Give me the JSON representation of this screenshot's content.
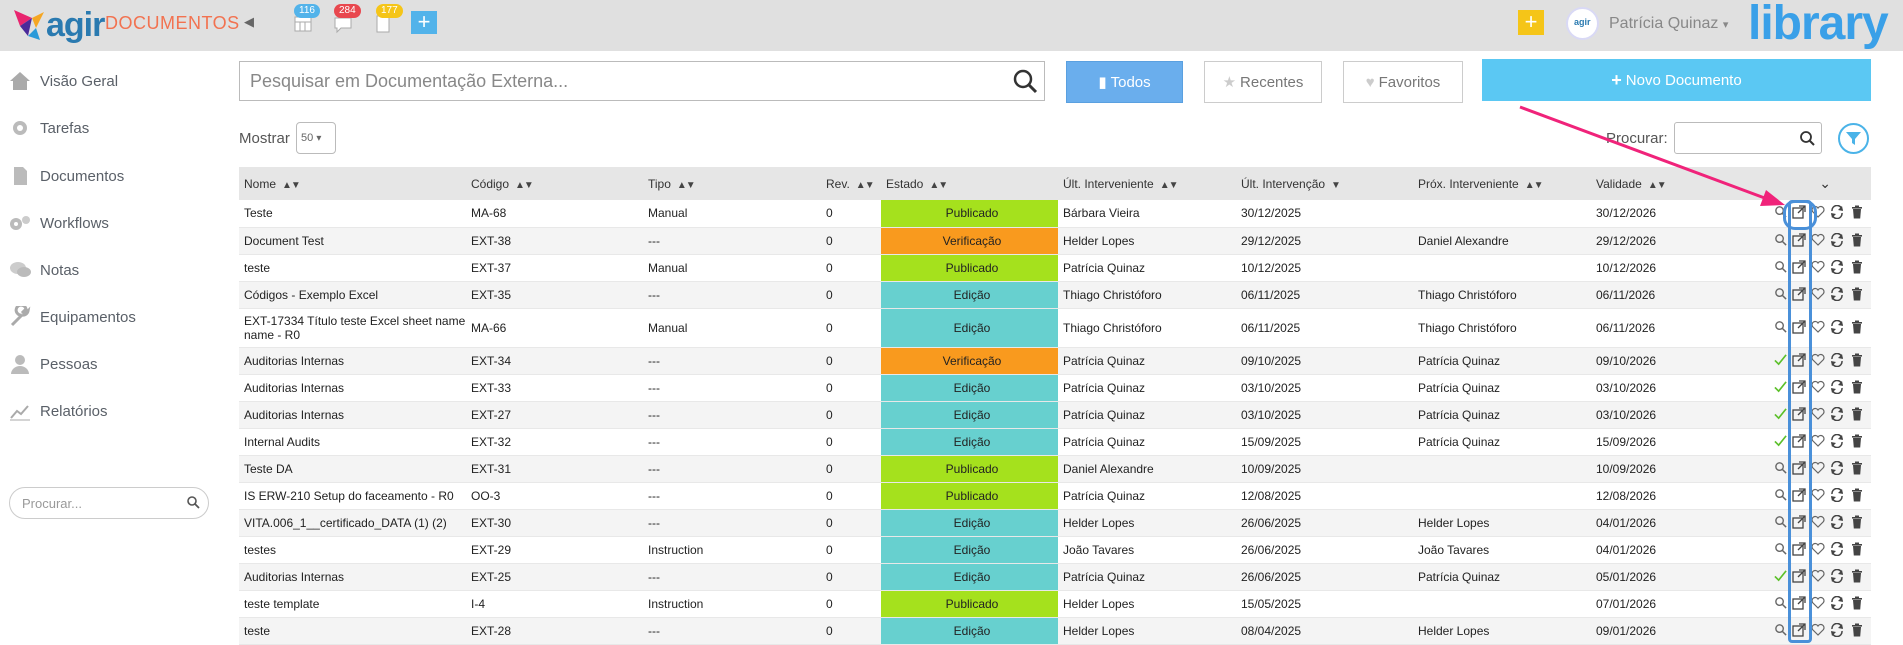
{
  "header": {
    "module_title": "DOCUMENTOS",
    "badges": [
      {
        "name": "calendar",
        "count": "116",
        "color": "#52b3ea"
      },
      {
        "name": "messages",
        "count": "284",
        "color": "#e8474e"
      },
      {
        "name": "tasks",
        "count": "177",
        "color": "#f5c518"
      }
    ],
    "user_name": "Patrícia Quinaz",
    "brand": "library",
    "logo_text": "agir",
    "avatar_text": "agir"
  },
  "sidebar": {
    "items": [
      {
        "label": "Visão Geral",
        "icon": "home-icon"
      },
      {
        "label": "Tarefas",
        "icon": "gear-icon"
      },
      {
        "label": "Documentos",
        "icon": "document-icon"
      },
      {
        "label": "Workflows",
        "icon": "cogs-icon"
      },
      {
        "label": "Notas",
        "icon": "chat-icon"
      },
      {
        "label": "Equipamentos",
        "icon": "wrench-icon"
      },
      {
        "label": "Pessoas",
        "icon": "person-icon"
      },
      {
        "label": "Relatórios",
        "icon": "chart-icon"
      }
    ],
    "search_placeholder": "Procurar..."
  },
  "toolbar": {
    "search_placeholder": "Pesquisar em Documentação Externa...",
    "filter_all": "Todos",
    "filter_recent": "Recentes",
    "filter_favorites": "Favoritos",
    "new_document": "Novo Documento"
  },
  "table_controls": {
    "show_label": "Mostrar",
    "page_size": "50",
    "search_label": "Procurar:"
  },
  "columns": [
    "Nome",
    "Código",
    "Tipo",
    "Rev.",
    "Estado",
    "Últ. Interveniente",
    "Últ. Intervenção",
    "Próx. Interveniente",
    "Validade"
  ],
  "rows": [
    {
      "nome": "Teste",
      "codigo": "MA-68",
      "tipo": "Manual",
      "rev": "0",
      "estado": "Publicado",
      "ult_int": "Bárbara Vieira",
      "ult_data": "30/12/2025",
      "prox": "",
      "validade": "30/12/2026",
      "val_color": "green",
      "first": "search"
    },
    {
      "nome": "Document Test",
      "codigo": "EXT-38",
      "tipo": "---",
      "rev": "0",
      "estado": "Verificação",
      "ult_int": "Helder Lopes",
      "ult_data": "29/12/2025",
      "prox": "Daniel Alexandre",
      "validade": "29/12/2026",
      "val_color": "green",
      "first": "search"
    },
    {
      "nome": "teste",
      "codigo": "EXT-37",
      "tipo": "Manual",
      "rev": "0",
      "estado": "Publicado",
      "ult_int": "Patrícia Quinaz",
      "ult_data": "10/12/2025",
      "prox": "",
      "validade": "10/12/2026",
      "val_color": "green",
      "first": "search"
    },
    {
      "nome": "Códigos - Exemplo Excel",
      "codigo": "EXT-35",
      "tipo": "---",
      "rev": "0",
      "estado": "Edição",
      "ult_int": "Thiago Christóforo",
      "ult_data": "06/11/2025",
      "prox": "Thiago Christóforo",
      "validade": "06/11/2026",
      "val_color": "green",
      "first": "search"
    },
    {
      "nome": "EXT-17334 Título teste Excel sheet name name - R0",
      "codigo": "MA-66",
      "tipo": "Manual",
      "rev": "0",
      "estado": "Edição",
      "ult_int": "Thiago Christóforo",
      "ult_data": "06/11/2025",
      "prox": "Thiago Christóforo",
      "validade": "06/11/2026",
      "val_color": "green",
      "first": "search",
      "tall": true
    },
    {
      "nome": "Auditorias Internas",
      "codigo": "EXT-34",
      "tipo": "---",
      "rev": "0",
      "estado": "Verificação",
      "ult_int": "Patrícia Quinaz",
      "ult_data": "09/10/2025",
      "prox": "Patrícia Quinaz",
      "validade": "09/10/2026",
      "val_color": "green",
      "first": "check"
    },
    {
      "nome": "Auditorias Internas",
      "codigo": "EXT-33",
      "tipo": "---",
      "rev": "0",
      "estado": "Edição",
      "ult_int": "Patrícia Quinaz",
      "ult_data": "03/10/2025",
      "prox": "Patrícia Quinaz",
      "validade": "03/10/2026",
      "val_color": "green",
      "first": "check"
    },
    {
      "nome": "Auditorias Internas",
      "codigo": "EXT-27",
      "tipo": "---",
      "rev": "0",
      "estado": "Edição",
      "ult_int": "Patrícia Quinaz",
      "ult_data": "03/10/2025",
      "prox": "Patrícia Quinaz",
      "validade": "03/10/2026",
      "val_color": "green",
      "first": "check"
    },
    {
      "nome": "Internal Audits",
      "codigo": "EXT-32",
      "tipo": "---",
      "rev": "0",
      "estado": "Edição",
      "ult_int": "Patrícia Quinaz",
      "ult_data": "15/09/2025",
      "prox": "Patrícia Quinaz",
      "validade": "15/09/2026",
      "val_color": "green",
      "first": "check"
    },
    {
      "nome": "Teste DA",
      "codigo": "EXT-31",
      "tipo": "---",
      "rev": "0",
      "estado": "Publicado",
      "ult_int": "Daniel Alexandre",
      "ult_data": "10/09/2025",
      "prox": "",
      "validade": "10/09/2026",
      "val_color": "green",
      "first": "search"
    },
    {
      "nome": "IS ERW-210 Setup do faceamento - R0",
      "codigo": "OO-3",
      "tipo": "---",
      "rev": "0",
      "estado": "Publicado",
      "ult_int": "Patrícia Quinaz",
      "ult_data": "12/08/2025",
      "prox": "",
      "validade": "12/08/2026",
      "val_color": "green",
      "first": "search"
    },
    {
      "nome": "VITA.006_1__certificado_DATA (1) (2)",
      "codigo": "EXT-30",
      "tipo": "---",
      "rev": "0",
      "estado": "Edição",
      "ult_int": "Helder Lopes",
      "ult_data": "26/06/2025",
      "prox": "Helder Lopes",
      "validade": "04/01/2026",
      "val_color": "red",
      "first": "search"
    },
    {
      "nome": "testes",
      "codigo": "EXT-29",
      "tipo": "Instruction",
      "rev": "0",
      "estado": "Edição",
      "ult_int": "João Tavares",
      "ult_data": "26/06/2025",
      "prox": "João Tavares",
      "validade": "04/01/2026",
      "val_color": "red",
      "first": "search"
    },
    {
      "nome": "Auditorias Internas",
      "codigo": "EXT-25",
      "tipo": "---",
      "rev": "0",
      "estado": "Edição",
      "ult_int": "Patrícia Quinaz",
      "ult_data": "26/06/2025",
      "prox": "Patrícia Quinaz",
      "validade": "05/01/2026",
      "val_color": "red",
      "first": "check"
    },
    {
      "nome": "teste template",
      "codigo": "I-4",
      "tipo": "Instruction",
      "rev": "0",
      "estado": "Publicado",
      "ult_int": "Helder Lopes",
      "ult_data": "15/05/2025",
      "prox": "",
      "validade": "07/01/2026",
      "val_color": "orange",
      "first": "search"
    },
    {
      "nome": "teste",
      "codigo": "EXT-28",
      "tipo": "---",
      "rev": "0",
      "estado": "Edição",
      "ult_int": "Helder Lopes",
      "ult_data": "08/04/2025",
      "prox": "Helder Lopes",
      "validade": "09/01/2026",
      "val_color": "orange",
      "first": "search"
    }
  ],
  "colors": {
    "publicado": "#a5e11d",
    "verificacao": "#f99a1e",
    "edicao": "#67d0cf",
    "accent": "#5bc8f3",
    "annotation_arrow": "#f0237a",
    "annotation_box": "#4a90d9"
  }
}
